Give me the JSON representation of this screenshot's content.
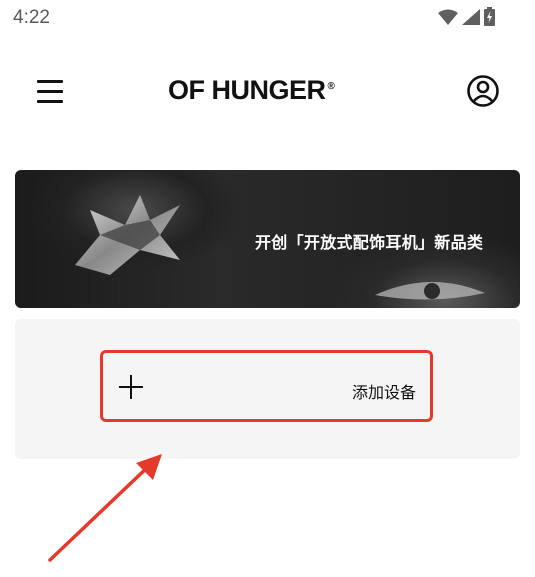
{
  "status_bar": {
    "time": "4:22",
    "icons": [
      "wifi-icon",
      "signal-icon",
      "battery-charging-icon"
    ]
  },
  "header": {
    "menu_icon": "hamburger-menu-icon",
    "brand": "OF HUNGER",
    "brand_mark": "®",
    "account_icon": "user-account-icon"
  },
  "banner": {
    "text": "开创「开放式配饰耳机」新品类"
  },
  "device_panel": {
    "add_button_icon": "plus-icon",
    "add_button_label": "添加设备"
  },
  "annotation": {
    "highlight_color": "#e43a2b"
  }
}
